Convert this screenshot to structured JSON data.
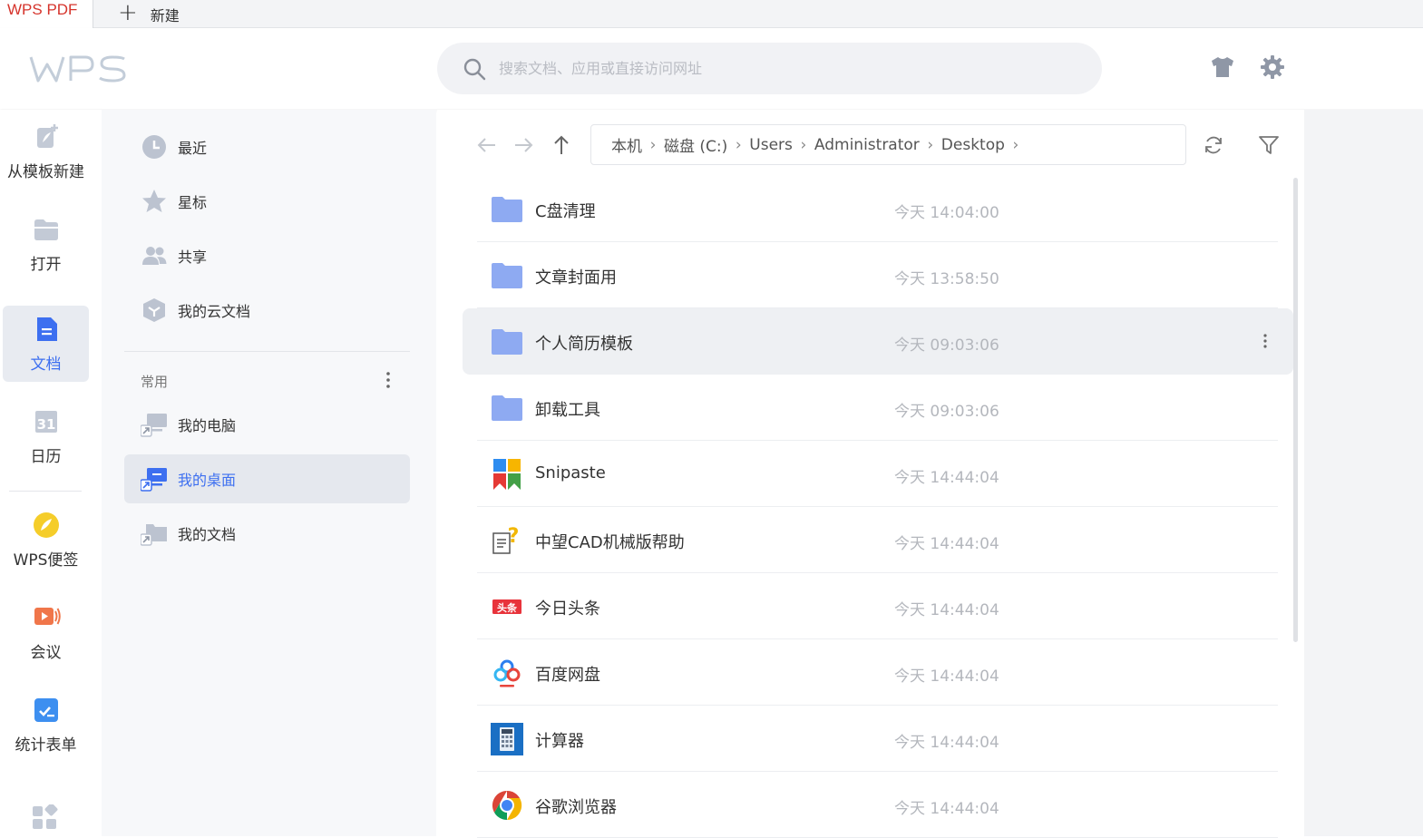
{
  "tabs": {
    "active_label": "WPS PDF",
    "new_label": "新建"
  },
  "header": {
    "search_placeholder": "搜索文档、应用或直接访问网址",
    "logo_text": "WPS"
  },
  "leftnav": [
    {
      "label": "从模板新建",
      "icon": "template-new-icon"
    },
    {
      "label": "打开",
      "icon": "folder-open-icon"
    },
    {
      "label": "文档",
      "icon": "document-icon"
    },
    {
      "label": "日历",
      "icon": "calendar-icon"
    },
    {
      "label": "WPS便签",
      "icon": "note-icon"
    },
    {
      "label": "会议",
      "icon": "meeting-icon"
    },
    {
      "label": "统计表单",
      "icon": "form-icon"
    }
  ],
  "sidebar": {
    "items": [
      {
        "label": "最近",
        "icon": "clock-icon"
      },
      {
        "label": "星标",
        "icon": "star-icon"
      },
      {
        "label": "共享",
        "icon": "people-icon"
      },
      {
        "label": "我的云文档",
        "icon": "cloud-doc-icon"
      }
    ],
    "section_title": "常用",
    "common": [
      {
        "label": "我的电脑",
        "icon": "computer-icon"
      },
      {
        "label": "我的桌面",
        "icon": "desktop-icon"
      },
      {
        "label": "我的文档",
        "icon": "docs-folder-icon"
      }
    ]
  },
  "breadcrumb": [
    "本机",
    "磁盘 (C:)",
    "Users",
    "Administrator",
    "Desktop"
  ],
  "files": [
    {
      "name": "C盘清理",
      "time": "今天 14:04:00",
      "icon": "folder-icon"
    },
    {
      "name": "文章封面用",
      "time": "今天 13:58:50",
      "icon": "folder-icon"
    },
    {
      "name": "个人简历模板",
      "time": "今天 09:03:06",
      "icon": "folder-icon"
    },
    {
      "name": "卸载工具",
      "time": "今天 09:03:06",
      "icon": "folder-icon"
    },
    {
      "name": "Snipaste",
      "time": "今天 14:44:04",
      "icon": "snipaste-icon"
    },
    {
      "name": "中望CAD机械版帮助",
      "time": "今天 14:44:04",
      "icon": "help-doc-icon"
    },
    {
      "name": "今日头条",
      "time": "今天 14:44:04",
      "icon": "toutiao-icon",
      "icon_text": "头条"
    },
    {
      "name": "百度网盘",
      "time": "今天 14:44:04",
      "icon": "baidu-netdisk-icon"
    },
    {
      "name": "计算器",
      "time": "今天 14:44:04",
      "icon": "calculator-icon"
    },
    {
      "name": "谷歌浏览器",
      "time": "今天 14:44:04",
      "icon": "chrome-icon"
    }
  ],
  "colors": {
    "accent": "#3d6ff0",
    "folder": "#8eaaf2",
    "brand_red": "#d6342c"
  }
}
